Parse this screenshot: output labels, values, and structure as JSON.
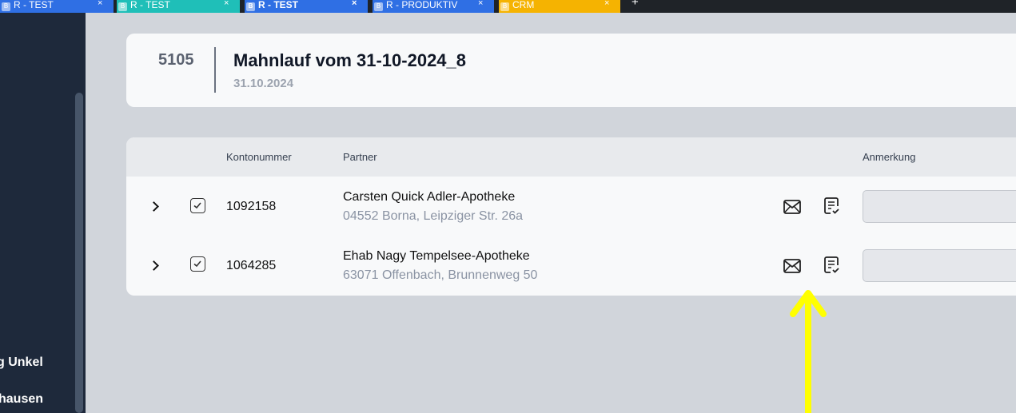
{
  "tabs": [
    {
      "label": "R - TEST",
      "color": "#2f6fe4",
      "close": "×"
    },
    {
      "label": "R - TEST",
      "color": "#1fbfb8",
      "close": "×"
    },
    {
      "label": "R - TEST",
      "color": "#2f6fe4",
      "close": "×"
    },
    {
      "label": "R - PRODUKTIV",
      "color": "#2f6fe4",
      "close": "×"
    },
    {
      "label": "CRM",
      "color": "#f5b301",
      "close": "×"
    }
  ],
  "tab_new": "+",
  "favicon_letter": "B",
  "sidebar": {
    "items": [
      {
        "label": "g Unkel"
      },
      {
        "label": "hausen"
      }
    ]
  },
  "header": {
    "number": "5105",
    "title": "Mahnlauf vom 31-10-2024_8",
    "date": "31.10.2024"
  },
  "table": {
    "columns": {
      "konto": "Kontonummer",
      "partner": "Partner",
      "anmerkung": "Anmerkung"
    },
    "rows": [
      {
        "konto": "1092158",
        "partner_name": "Carsten Quick Adler-Apotheke",
        "partner_address": "04552 Borna, Leipziger Str. 26a",
        "checked": true,
        "remark": ""
      },
      {
        "konto": "1064285",
        "partner_name": "Ehab Nagy Tempelsee-Apotheke",
        "partner_address": "63071 Offenbach, Brunnenweg 50",
        "checked": true,
        "remark": ""
      }
    ]
  },
  "annotation": {
    "color": "#ffff00",
    "icon": "arrow-up-icon"
  }
}
